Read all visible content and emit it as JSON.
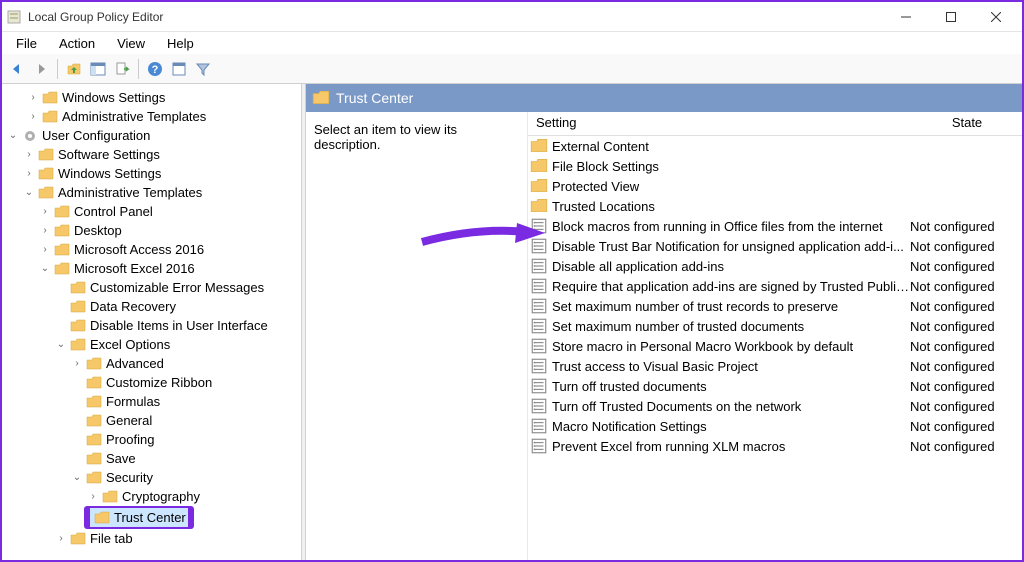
{
  "window": {
    "title": "Local Group Policy Editor"
  },
  "menubar": [
    "File",
    "Action",
    "View",
    "Help"
  ],
  "right": {
    "header": "Trust Center",
    "description": "Select an item to view its description.",
    "columns": {
      "setting": "Setting",
      "state": "State"
    },
    "rows": [
      {
        "type": "folder",
        "label": "External Content",
        "state": ""
      },
      {
        "type": "folder",
        "label": "File Block Settings",
        "state": ""
      },
      {
        "type": "folder",
        "label": "Protected View",
        "state": ""
      },
      {
        "type": "folder",
        "label": "Trusted Locations",
        "state": ""
      },
      {
        "type": "setting",
        "label": "Block macros from running in Office files from the internet",
        "state": "Not configured"
      },
      {
        "type": "setting",
        "label": "Disable Trust Bar Notification for unsigned application add-i...",
        "state": "Not configured"
      },
      {
        "type": "setting",
        "label": "Disable all application add-ins",
        "state": "Not configured"
      },
      {
        "type": "setting",
        "label": "Require that application add-ins are signed by Trusted Publis...",
        "state": "Not configured"
      },
      {
        "type": "setting",
        "label": "Set maximum number of trust records to preserve",
        "state": "Not configured"
      },
      {
        "type": "setting",
        "label": "Set maximum number of trusted documents",
        "state": "Not configured"
      },
      {
        "type": "setting",
        "label": "Store macro in Personal Macro Workbook by default",
        "state": "Not configured"
      },
      {
        "type": "setting",
        "label": "Trust access to Visual Basic Project",
        "state": "Not configured"
      },
      {
        "type": "setting",
        "label": "Turn off trusted documents",
        "state": "Not configured"
      },
      {
        "type": "setting",
        "label": "Turn off Trusted Documents on the network",
        "state": "Not configured"
      },
      {
        "type": "setting",
        "label": "Macro Notification Settings",
        "state": "Not configured"
      },
      {
        "type": "setting",
        "label": "Prevent Excel from running XLM macros",
        "state": "Not configured"
      }
    ]
  },
  "tree": {
    "windows_settings": "Windows Settings",
    "admin_templates_top": "Administrative Templates",
    "user_config": "User Configuration",
    "software_settings": "Software Settings",
    "windows_settings2": "Windows Settings",
    "admin_templates": "Administrative Templates",
    "control_panel": "Control Panel",
    "desktop": "Desktop",
    "access2016": "Microsoft Access 2016",
    "excel2016": "Microsoft Excel 2016",
    "custom_errors": "Customizable Error Messages",
    "data_recovery": "Data Recovery",
    "disable_items": "Disable Items in User Interface",
    "excel_options": "Excel Options",
    "advanced": "Advanced",
    "customize_ribbon": "Customize Ribbon",
    "formulas": "Formulas",
    "general": "General",
    "proofing": "Proofing",
    "save": "Save",
    "security": "Security",
    "cryptography": "Cryptography",
    "trust_center": "Trust Center",
    "file_tab": "File tab"
  }
}
